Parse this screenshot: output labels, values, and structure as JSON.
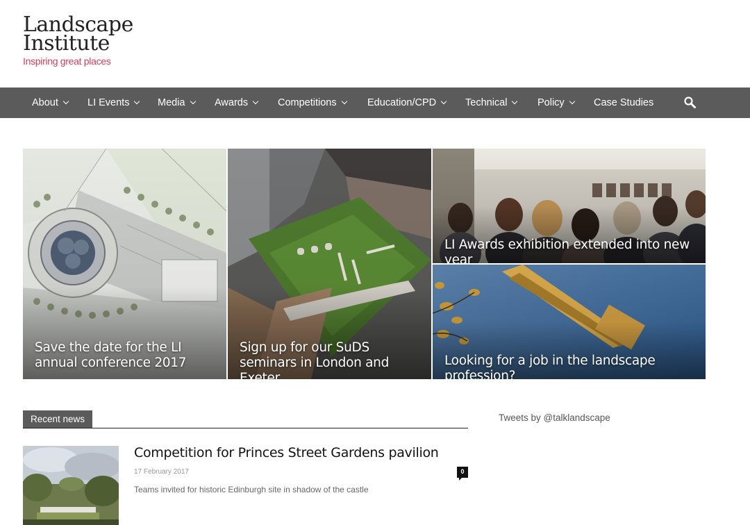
{
  "logo": {
    "line1": "Landscape",
    "line2": "Institute",
    "tagline": "Inspiring great places",
    "tagline_color": "#d0405a"
  },
  "nav": {
    "items": [
      {
        "label": "About",
        "has_dropdown": true
      },
      {
        "label": "LI Events",
        "has_dropdown": true
      },
      {
        "label": "Media",
        "has_dropdown": true
      },
      {
        "label": "Awards",
        "has_dropdown": true
      },
      {
        "label": "Competitions",
        "has_dropdown": true
      },
      {
        "label": "Education/CPD",
        "has_dropdown": true
      },
      {
        "label": "Technical",
        "has_dropdown": true
      },
      {
        "label": "Policy",
        "has_dropdown": true
      },
      {
        "label": "Case Studies",
        "has_dropdown": false
      }
    ],
    "search_icon": "search-icon",
    "background": "#5b5b5b"
  },
  "hero": {
    "tiles": [
      {
        "caption": "Save the date for the LI annual conference 2017"
      },
      {
        "caption": "Sign up for our SuDS seminars in London and Exeter"
      },
      {
        "caption": "LI Awards exhibition extended into new year"
      },
      {
        "caption": "Looking for a job in the landscape profession?"
      }
    ]
  },
  "recent_news": {
    "label": "Recent news",
    "items": [
      {
        "title": "Competition for Princes Street Gardens pavilion",
        "date": "17 February 2017",
        "excerpt": "Teams invited for historic Edinburgh site in shadow of the castle",
        "comments": "0"
      }
    ]
  },
  "tweets": {
    "label": "Tweets by @talklandscape"
  }
}
